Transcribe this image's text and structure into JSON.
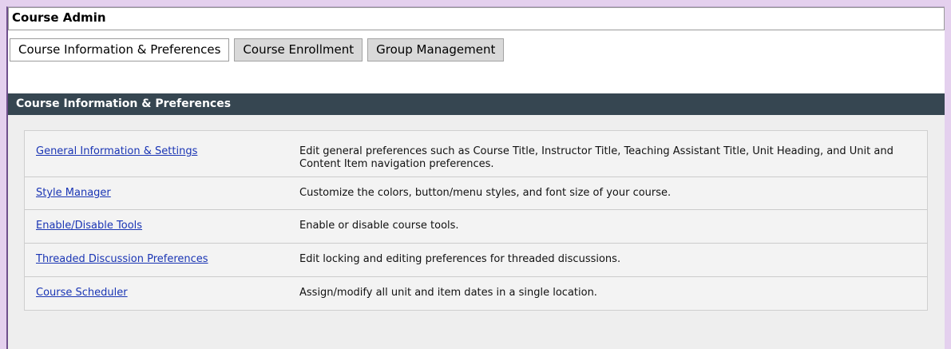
{
  "header": {
    "title": "Course Admin"
  },
  "tabs": [
    {
      "label": "Course Information & Preferences",
      "active": true
    },
    {
      "label": "Course Enrollment",
      "active": false
    },
    {
      "label": "Group Management",
      "active": false
    }
  ],
  "section": {
    "title": "Course Information & Preferences"
  },
  "items": [
    {
      "link": "General Information & Settings",
      "description": "Edit general preferences such as Course Title, Instructor Title, Teaching Assistant Title, Unit Heading, and Unit and Content Item navigation preferences."
    },
    {
      "link": "Style Manager",
      "description": "Customize the colors, button/menu styles, and font size of your course."
    },
    {
      "link": "Enable/Disable Tools",
      "description": "Enable or disable course tools."
    },
    {
      "link": "Threaded Discussion Preferences",
      "description": "Edit locking and editing preferences for threaded discussions."
    },
    {
      "link": "Course Scheduler",
      "description": "Assign/modify all unit and item dates in a single location."
    }
  ],
  "colors": {
    "section_bar": "#364651",
    "link": "#1a35b4",
    "frame_border": "#6f4f8c"
  }
}
